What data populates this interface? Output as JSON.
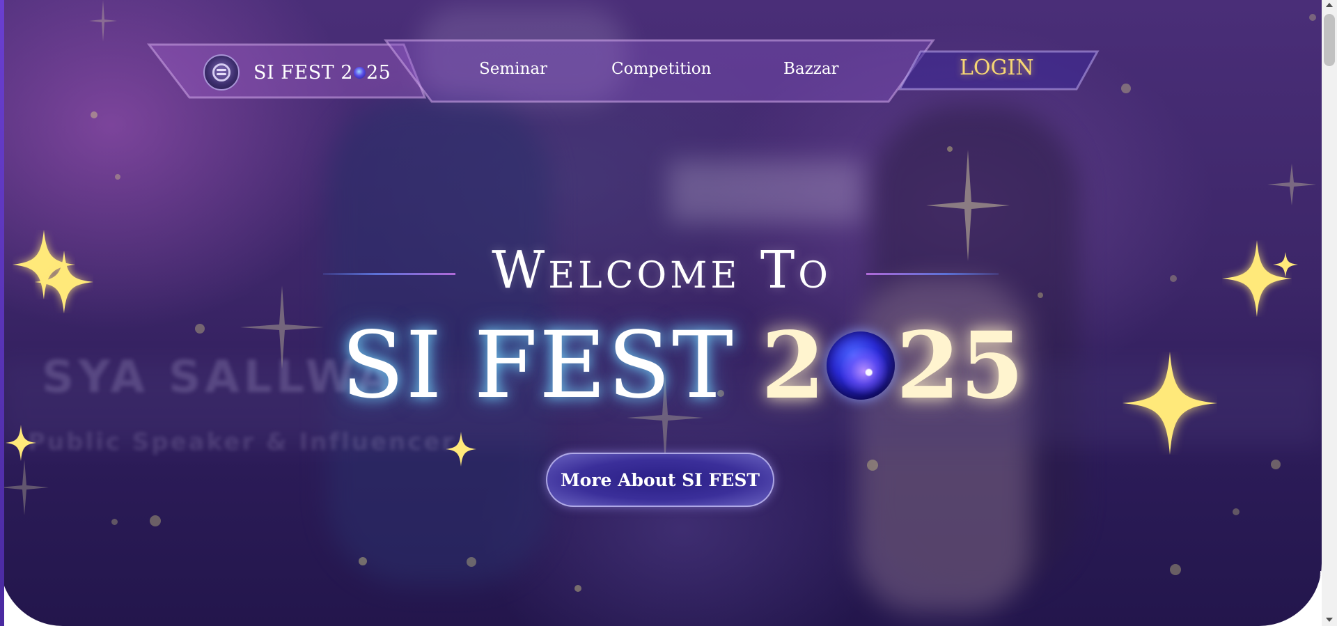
{
  "nav": {
    "brand": {
      "prefix": "SI FEST 2",
      "suffix": "25"
    },
    "links": {
      "seminar": "Seminar",
      "competition": "Competition",
      "bazzar": "Bazzar"
    },
    "login": "LOGIN"
  },
  "hero": {
    "welcome": "Welcome To",
    "title_main": "SI FEST",
    "title_year": {
      "first": "2",
      "last": "25"
    },
    "button": "More About SI FEST"
  },
  "background": {
    "blurred_banner_text": "SYA SALLWA",
    "blurred_banner_subtext": "Public Speaker & Influencer"
  },
  "colors": {
    "accent_gold": "#f7d774",
    "star_yellow": "#ffe97a",
    "hero_purple": "#3c2668",
    "button_indigo": "#2a1f86"
  },
  "icons": {
    "logo": "si-fest-emblem-icon",
    "orb": "planet-orb-icon",
    "star": "four-point-sparkle-icon"
  }
}
